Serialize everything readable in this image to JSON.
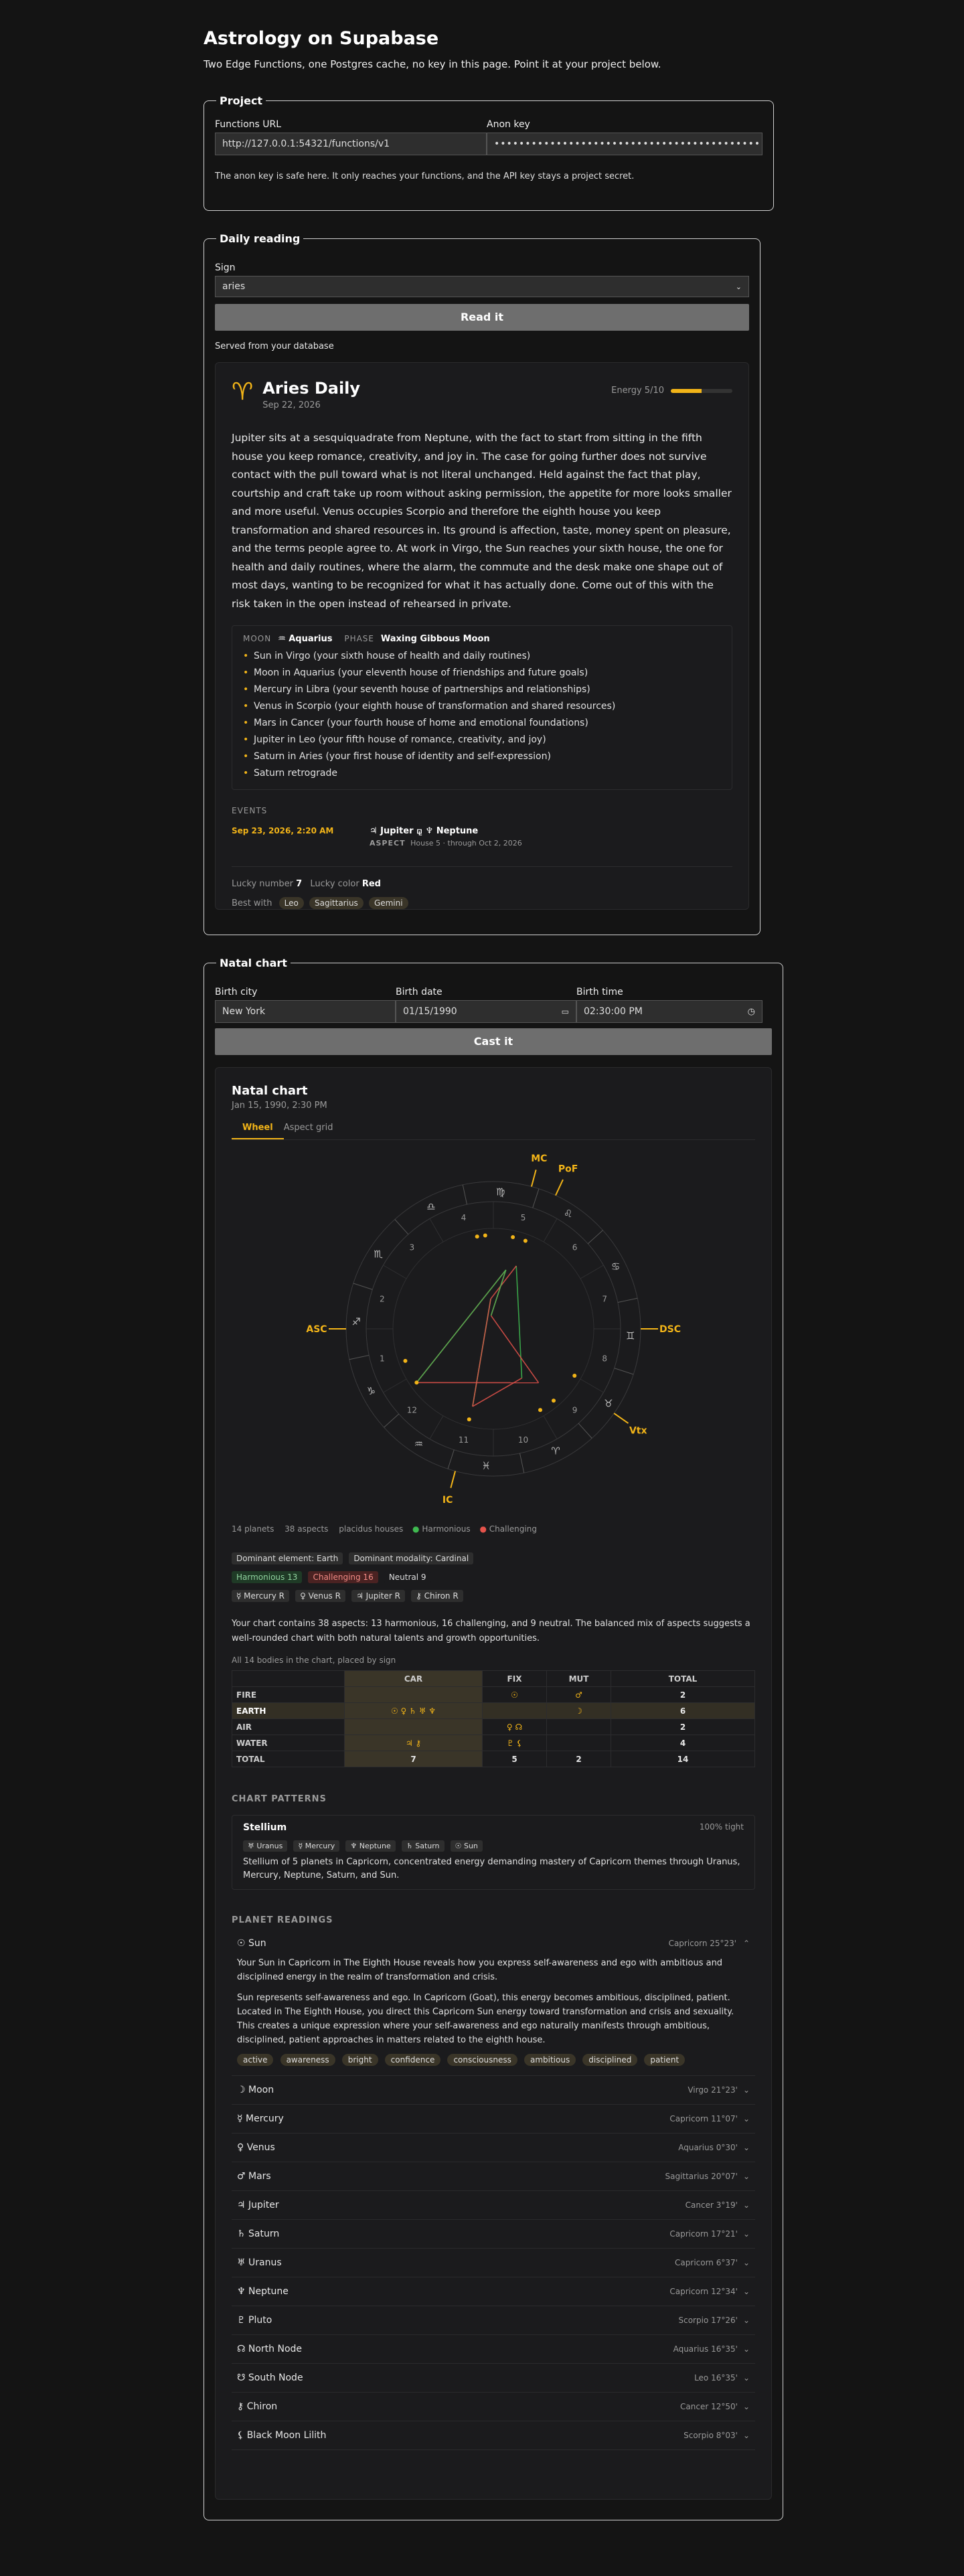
{
  "header": {
    "title": "Astrology on Supabase",
    "subtitle": "Two Edge Functions, one Postgres cache, no key in this page. Point it at your project below."
  },
  "project": {
    "legend": "Project",
    "functions_url_label": "Functions URL",
    "functions_url_value": "http://127.0.0.1:54321/functions/v1",
    "anon_key_label": "Anon key",
    "anon_key_value": "••••••••••••••••••••••••••••••••••••••••••••••",
    "note": "The anon key is safe here. It only reaches your functions, and the API key stays a project secret."
  },
  "daily": {
    "legend": "Daily reading",
    "sign_label": "Sign",
    "sign_value": "aries",
    "button": "Read it",
    "source_note": "Served from your database",
    "card": {
      "glyph": "♈",
      "title": "Aries Daily",
      "date": "Sep 22, 2026",
      "energy_label": "Energy 5/10",
      "energy_level": 0.5,
      "body": "Jupiter sits at a sesquiquadrate from Neptune, with the fact to start from sitting in the fifth house you keep romance, creativity, and joy in. The case for going further does not survive contact with the pull toward what is not literal unchanged. Held against the fact that play, courtship and craft take up room without asking permission, the appetite for more looks smaller and more useful. Venus occupies Scorpio and therefore the eighth house you keep transformation and shared resources in. Its ground is affection, taste, money spent on pleasure, and the terms people agree to. At work in Virgo, the Sun reaches your sixth house, the one for health and daily routines, where the alarm, the commute and the desk make one shape out of most days, wanting to be recognized for what it has actually done. Come out of this with the risk taken in the open instead of rehearsed in private.",
      "moon_label": "MOON",
      "moon_value": "♒ Aquarius",
      "phase_label": "PHASE",
      "phase_value": "Waxing Gibbous Moon",
      "positions": [
        "Sun in Virgo (your sixth house of health and daily routines)",
        "Moon in Aquarius (your eleventh house of friendships and future goals)",
        "Mercury in Libra (your seventh house of partnerships and relationships)",
        "Venus in Scorpio (your eighth house of transformation and shared resources)",
        "Mars in Cancer (your fourth house of home and emotional foundations)",
        "Jupiter in Leo (your fifth house of romance, creativity, and joy)",
        "Saturn in Aries (your first house of identity and self-expression)",
        "Saturn retrograde"
      ],
      "events_label": "EVENTS",
      "event_time": "Sep 23, 2026, 2:20 AM",
      "event_title": "♃ Jupiter ⚼ ♆ Neptune",
      "event_aspect_label": "ASPECT",
      "event_detail": "House 5 · through Oct 2, 2026",
      "lucky_number_label": "Lucky number",
      "lucky_number": "7",
      "lucky_color_label": "Lucky color",
      "lucky_color": "Red",
      "best_with_label": "Best with",
      "best_with": [
        "Leo",
        "Sagittarius",
        "Gemini"
      ]
    }
  },
  "natal": {
    "legend": "Natal chart",
    "city_label": "Birth city",
    "city_value": "New York",
    "date_label": "Birth date",
    "date_value": "01/15/1990",
    "time_label": "Birth time",
    "time_value": "02:30:00 PM",
    "button": "Cast it",
    "card": {
      "title": "Natal chart",
      "date": "Jan 15, 1990, 2:30 PM",
      "tabs": [
        "Wheel",
        "Aspect grid"
      ],
      "angles": {
        "mc": "MC",
        "pof": "PoF",
        "asc": "ASC",
        "dsc": "DSC",
        "ic": "IC",
        "vtx": "Vtx"
      },
      "house_numbers": [
        "1",
        "2",
        "3",
        "4",
        "5",
        "6",
        "7",
        "8",
        "9",
        "10",
        "11",
        "12"
      ],
      "sign_glyphs": [
        "♈",
        "♉",
        "♊",
        "♋",
        "♌",
        "♍",
        "♎",
        "♏",
        "♐",
        "♑",
        "♒",
        "♓"
      ],
      "stats": {
        "planets": "14 planets",
        "aspects": "38 aspects",
        "houses": "placidus houses",
        "harmonious": "Harmonious",
        "challenging": "Challenging"
      },
      "dominant_element": "Dominant element: Earth",
      "dominant_modality": "Dominant modality: Cardinal",
      "harmonious_tag": "Harmonious 13",
      "challenging_tag": "Challenging 16",
      "neutral_tag": "Neutral 9",
      "retro_tags": [
        "☿ Mercury R",
        "♀ Venus R",
        "♃ Jupiter R",
        "⚷ Chiron R"
      ],
      "summary": "Your chart contains 38 aspects: 13 harmonious, 16 challenging, and 9 neutral. The balanced mix of aspects suggests a well-rounded chart with both natural talents and growth opportunities.",
      "table_caption": "All 14 bodies in the chart, placed by sign",
      "table_headers": [
        "",
        "CAR",
        "FIX",
        "MUT",
        "TOTAL"
      ],
      "table_rows": [
        {
          "label": "FIRE",
          "car": "",
          "fix": "☉",
          "mut": "♂",
          "total": "2"
        },
        {
          "label": "EARTH",
          "car": "☉ ♀ ♄ ♅ ♆",
          "fix": "",
          "mut": "☽",
          "total": "6"
        },
        {
          "label": "AIR",
          "car": "",
          "fix": "♀ ☊",
          "mut": "",
          "total": "2"
        },
        {
          "label": "WATER",
          "car": "♃ ⚷",
          "fix": "♇ ⚸",
          "mut": "",
          "total": "4"
        },
        {
          "label": "TOTAL",
          "car": "7",
          "fix": "5",
          "mut": "2",
          "total": "14"
        }
      ],
      "patterns_label": "CHART PATTERNS",
      "pattern_title": "Stellium",
      "pattern_tight": "100% tight",
      "pattern_tags": [
        "♅ Uranus",
        "☿ Mercury",
        "♆ Neptune",
        "♄ Saturn",
        "☉ Sun"
      ],
      "pattern_desc": "Stellium of 5 planets in Capricorn, concentrated energy demanding mastery of Capricorn themes through Uranus, Mercury, Neptune, Saturn, and Sun.",
      "readings_label": "PLANET READINGS",
      "sun_reading": {
        "name": "☉ Sun",
        "pos": "Capricorn 25°23'",
        "p1": "Your Sun in Capricorn in The Eighth House reveals how you express self-awareness and ego with ambitious and disciplined energy in the realm of transformation and crisis.",
        "p2": "Sun represents self-awareness and ego. In Capricorn (Goat), this energy becomes ambitious, disciplined, patient. Located in The Eighth House, you direct this Capricorn Sun energy toward transformation and crisis and sexuality. This creates a unique expression where your self-awareness and ego naturally manifests through ambitious, disciplined, patient approaches in matters related to the eighth house.",
        "keywords": [
          "active",
          "awareness",
          "bright",
          "confidence",
          "consciousness",
          "ambitious",
          "disciplined",
          "patient"
        ]
      },
      "readings": [
        {
          "name": "☽ Moon",
          "pos": "Virgo 21°23'"
        },
        {
          "name": "☿ Mercury",
          "pos": "Capricorn 11°07'"
        },
        {
          "name": "♀ Venus",
          "pos": "Aquarius 0°30'"
        },
        {
          "name": "♂ Mars",
          "pos": "Sagittarius 20°07'"
        },
        {
          "name": "♃ Jupiter",
          "pos": "Cancer 3°19'"
        },
        {
          "name": "♄ Saturn",
          "pos": "Capricorn 17°21'"
        },
        {
          "name": "♅ Uranus",
          "pos": "Capricorn 6°37'"
        },
        {
          "name": "♆ Neptune",
          "pos": "Capricorn 12°34'"
        },
        {
          "name": "♇ Pluto",
          "pos": "Scorpio 17°26'"
        },
        {
          "name": "☊ North Node",
          "pos": "Aquarius 16°35'"
        },
        {
          "name": "☋ South Node",
          "pos": "Leo 16°35'"
        },
        {
          "name": "⚷ Chiron",
          "pos": "Cancer 12°50'"
        },
        {
          "name": "⚸ Black Moon Lilith",
          "pos": "Scorpio 8°03'"
        }
      ]
    }
  },
  "colors": {
    "accent": "#f2b418",
    "harmonious": "#3fb950",
    "challenging": "#e5534b"
  }
}
